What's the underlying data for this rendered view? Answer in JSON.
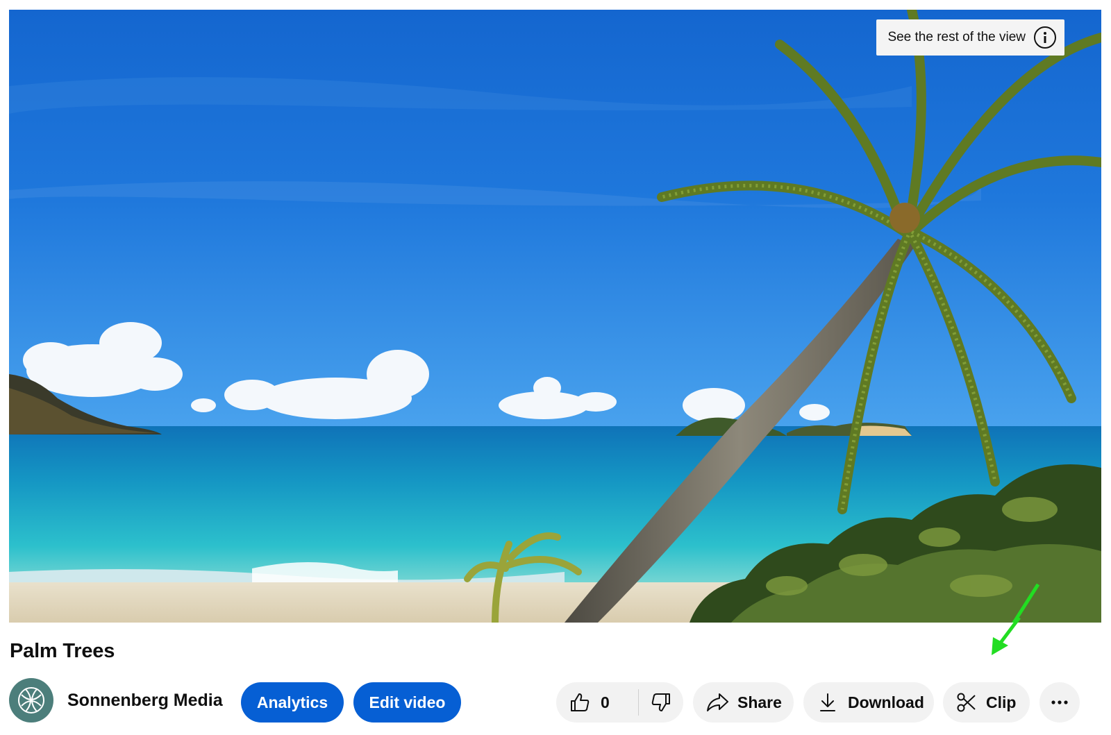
{
  "video": {
    "title": "Palm Trees",
    "overlay_hint": "See the rest of the view"
  },
  "channel": {
    "name": "Sonnenberg Media"
  },
  "owner_actions": {
    "analytics_label": "Analytics",
    "edit_label": "Edit video"
  },
  "actions": {
    "like_count": "0",
    "share_label": "Share",
    "download_label": "Download",
    "clip_label": "Clip"
  },
  "colors": {
    "primary_button": "#065fd4",
    "pill_background": "#f2f2f2",
    "annotation_arrow": "#22dd22"
  },
  "icons": [
    "info-icon",
    "like-icon",
    "dislike-icon",
    "share-icon",
    "download-icon",
    "scissors-icon",
    "more-icon",
    "channel-logo-icon"
  ]
}
